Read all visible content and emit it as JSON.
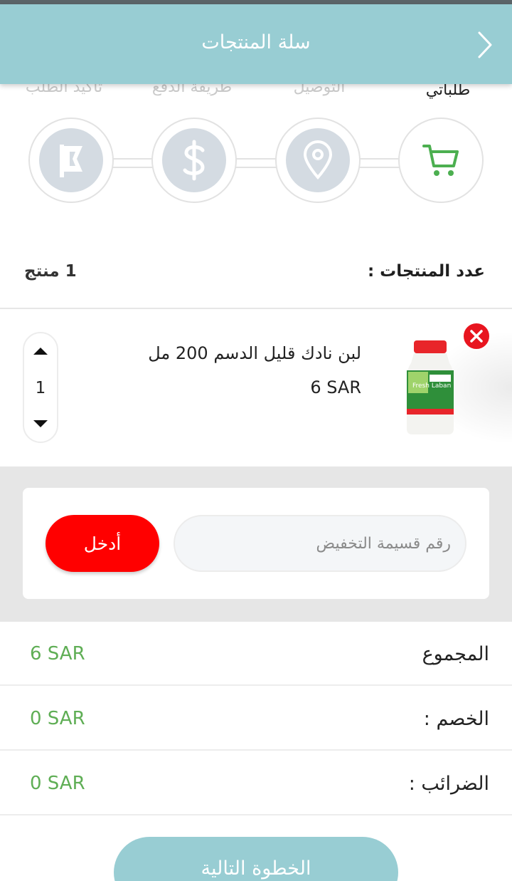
{
  "header": {
    "title": "سلة المنتجات",
    "back_icon": "chevron-right-icon"
  },
  "steps": [
    {
      "label": "طلباتي",
      "icon": "cart-icon",
      "active": true
    },
    {
      "label": "التوصيل",
      "icon": "location-pin-icon",
      "active": false
    },
    {
      "label": "طريقة الدفع",
      "icon": "dollar-icon",
      "active": false
    },
    {
      "label": "تأكيد الطلب",
      "icon": "flag-icon",
      "active": false
    }
  ],
  "summary_count": {
    "label": "عدد المنتجات :",
    "value": "1 منتج"
  },
  "product": {
    "name": "لبن نادك قليل الدسم 200 مل",
    "price": "6 SAR",
    "quantity": "1",
    "image_text": "Fresh Laban"
  },
  "coupon": {
    "placeholder": "رقم قسيمة التخفيض",
    "button_label": "أدخل"
  },
  "totals": {
    "subtotal_label": "المجموع",
    "subtotal_value": "6 SAR",
    "discount_label": "الخصم :",
    "discount_value": "0 SAR",
    "tax_label": "الضرائب :",
    "tax_value": "0 SAR"
  },
  "next_button": {
    "label": "الخطوة التالية"
  },
  "colors": {
    "primary": "#98cdd3",
    "danger": "#ff0000",
    "price_green": "#5fae55",
    "step_inactive": "#d4dbe2",
    "cart_green": "#4caf50"
  }
}
